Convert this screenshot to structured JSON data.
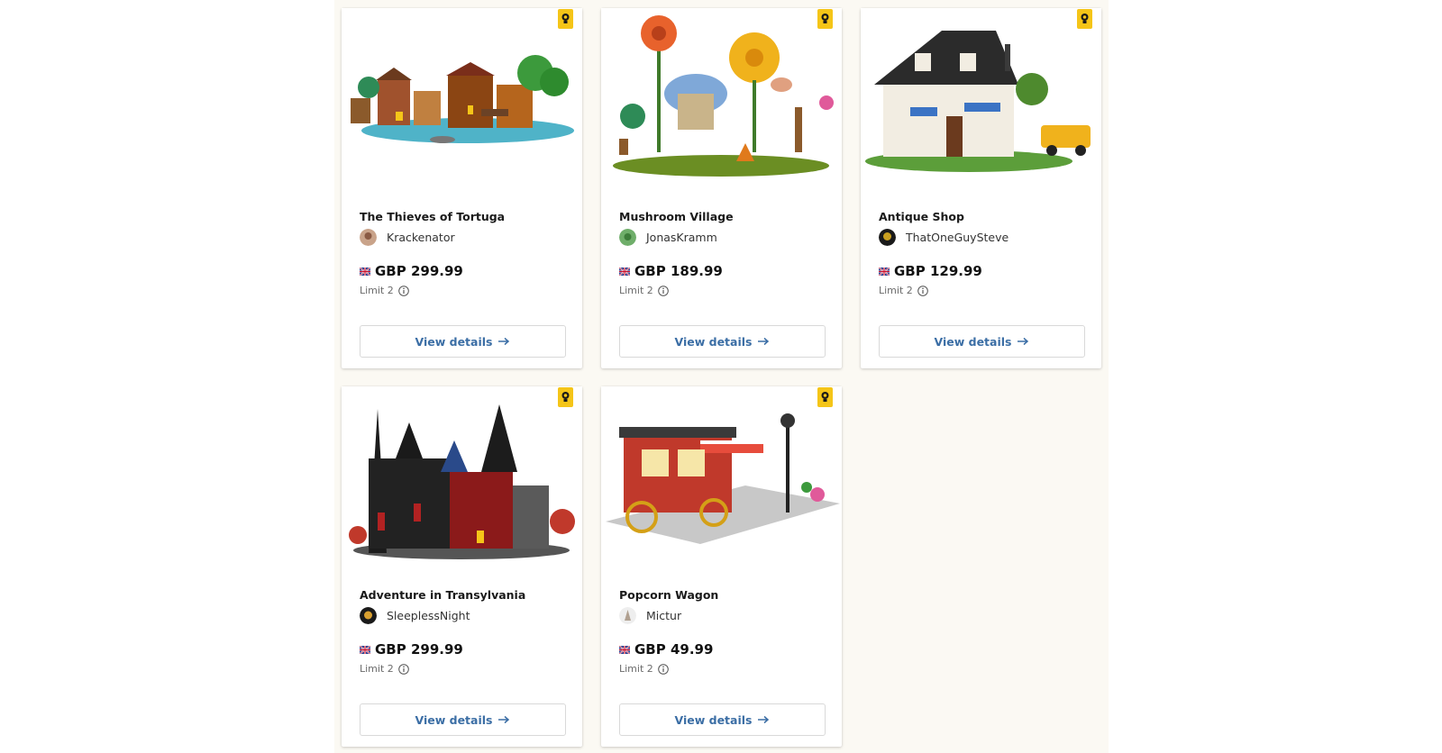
{
  "colors": {
    "page_background": "#fbf9f3",
    "badge": "#f5c518",
    "link": "#3b6ea5"
  },
  "products": [
    {
      "name": "The Thieves of Tortuga",
      "creator": "Krackenator",
      "price": "GBP 299.99",
      "limit": "Limit 2",
      "button": "View details",
      "image": "pirate-village-model"
    },
    {
      "name": "Mushroom Village",
      "creator": "JonasKramm",
      "price": "GBP 189.99",
      "limit": "Limit 2",
      "button": "View details",
      "image": "mushroom-village-model"
    },
    {
      "name": "Antique Shop",
      "creator": "ThatOneGuySteve",
      "price": "GBP 129.99",
      "limit": "Limit 2",
      "button": "View details",
      "image": "antique-shop-model"
    },
    {
      "name": "Adventure in Transylvania",
      "creator": "SleeplessNight",
      "price": "GBP 299.99",
      "limit": "Limit 2",
      "button": "View details",
      "image": "gothic-castle-model"
    },
    {
      "name": "Popcorn Wagon",
      "creator": "Mictur",
      "price": "GBP 49.99",
      "limit": "Limit 2",
      "button": "View details",
      "image": "popcorn-wagon-model"
    }
  ]
}
